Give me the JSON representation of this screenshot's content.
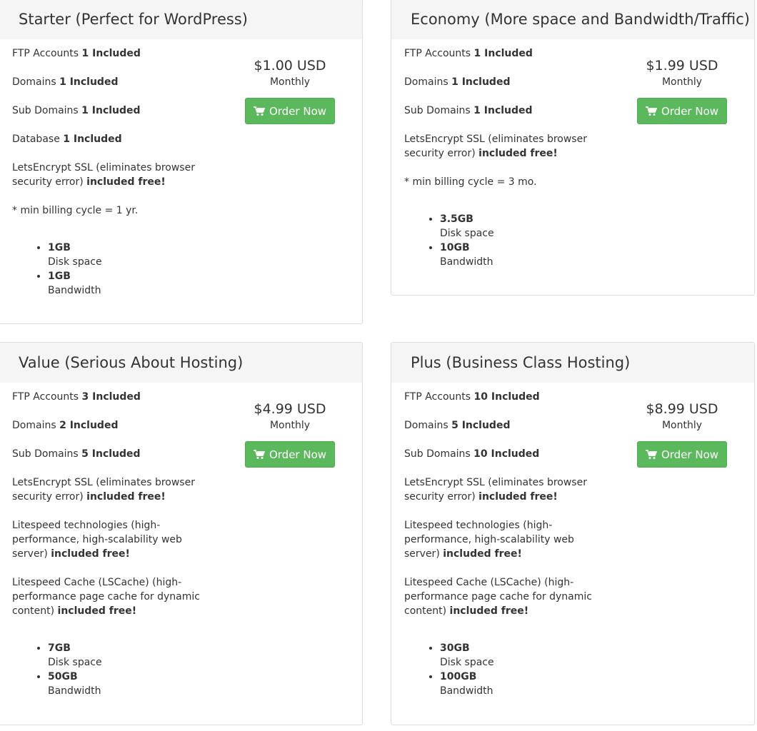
{
  "colors": {
    "button": "#5cb85c",
    "header_bg": "#f5f5f5",
    "border": "#dddddd"
  },
  "plans": [
    {
      "title": "Starter (Perfect for WordPress)",
      "price": "$1.00 USD",
      "cycle": "Monthly",
      "button": "Order Now",
      "ftp_label": "FTP Accounts",
      "ftp_value": "1 Included",
      "domains_label": "Domains",
      "domains_value": "1 Included",
      "subdomains_label": "Sub Domains",
      "subdomains_value": "1 Included",
      "database_label": "Database",
      "database_value": "1 Included",
      "ssl_text": "LetsEncrypt SSL (eliminates browser security error)",
      "ssl_bold": "included free!",
      "note": "* min billing cycle = 1 yr.",
      "disk_value": "1GB",
      "disk_label": "Disk space",
      "bw_value": "1GB",
      "bw_label": "Bandwidth"
    },
    {
      "title": "Economy (More space and Bandwidth/Traffic)",
      "price": "$1.99 USD",
      "cycle": "Monthly",
      "button": "Order Now",
      "ftp_label": "FTP Accounts",
      "ftp_value": "1 Included",
      "domains_label": "Domains",
      "domains_value": "1 Included",
      "subdomains_label": "Sub Domains",
      "subdomains_value": "1 Included",
      "ssl_text": "LetsEncrypt SSL (eliminates browser security error)",
      "ssl_bold": "included free!",
      "note": "* min billing cycle = 3 mo.",
      "disk_value": "3.5GB",
      "disk_label": "Disk space",
      "bw_value": "10GB",
      "bw_label": "Bandwidth"
    },
    {
      "title": "Value (Serious About Hosting)",
      "price": "$4.99 USD",
      "cycle": "Monthly",
      "button": "Order Now",
      "ftp_label": "FTP Accounts",
      "ftp_value": "3 Included",
      "domains_label": "Domains",
      "domains_value": "2 Included",
      "subdomains_label": "Sub Domains",
      "subdomains_value": "5 Included",
      "ssl_text": "LetsEncrypt SSL (eliminates browser security error)",
      "ssl_bold": "included free!",
      "litespeed_text": "Litespeed technologies (high-performance, high-scalability web server)",
      "litespeed_bold": "included free!",
      "lscache_text": "Litespeed Cache (LSCache) (high-performance page cache for dynamic content)",
      "lscache_bold": "included free!",
      "disk_value": "7GB",
      "disk_label": "Disk space",
      "bw_value": "50GB",
      "bw_label": "Bandwidth"
    },
    {
      "title": "Plus (Business Class Hosting)",
      "price": "$8.99 USD",
      "cycle": "Monthly",
      "button": "Order Now",
      "ftp_label": "FTP Accounts",
      "ftp_value": "10 Included",
      "domains_label": "Domains",
      "domains_value": "5 Included",
      "subdomains_label": "Sub Domains",
      "subdomains_value": "10 Included",
      "ssl_text": "LetsEncrypt SSL (eliminates browser security error)",
      "ssl_bold": "included free!",
      "litespeed_text": "Litespeed technologies (high-performance, high-scalability web server)",
      "litespeed_bold": "included free!",
      "lscache_text": "Litespeed Cache (LSCache) (high-performance page cache for dynamic content)",
      "lscache_bold": "included free!",
      "disk_value": "30GB",
      "disk_label": "Disk space",
      "bw_value": "100GB",
      "bw_label": "Bandwidth"
    }
  ]
}
